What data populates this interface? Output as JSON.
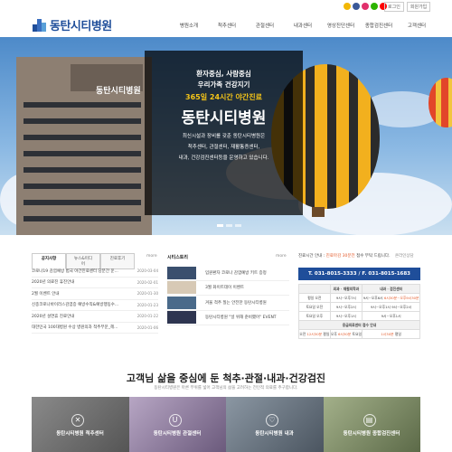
{
  "header": {
    "logo_text": "동탄시티병원",
    "util": [
      "로그인",
      "회원가입"
    ],
    "nav": [
      "병원소개",
      "척추센터",
      "관절센터",
      "내과센터",
      "영상진단센터",
      "종합검진센터",
      "고객센터"
    ],
    "social_colors": [
      "#f2b705",
      "#3b5998",
      "#e1306c",
      "#2db400",
      "#ff0000"
    ]
  },
  "hero": {
    "line1": "환자중심, 사람중심",
    "line2": "우리가족 건강지기",
    "line3": "365일 24시간 야간진료",
    "line4": "동탄시티병원",
    "desc1": "최신시설과 장비를 갖춘 동탄시티병원은",
    "desc2": "척추센터, 관절센터, 재활통증센터,",
    "desc3": "내과, 건강검진센터등을 운영하고 있습니다.",
    "building_sign": "동탄시티병원",
    "accent": "#f5c518"
  },
  "notice": {
    "tabs": [
      "공지사항",
      "뉴스&미디어",
      "진료후기"
    ],
    "more": "more",
    "items": [
      {
        "title": "코로나19 감염예방 범국 야간진료센터 당분간 운...",
        "date": "2020-03-04"
      },
      {
        "title": "2020년 의료진 휴진안내",
        "date": "2020-02-01"
      },
      {
        "title": "2월 이벤트 안내",
        "date": "2020-01-30"
      },
      {
        "title": "신종코로나바이러스감염증 예방수칙&예방행동수...",
        "date": "2020-01-23"
      },
      {
        "title": "2020년 설연휴 진료안내",
        "date": "2020-01-22"
      },
      {
        "title": "대한민국 100대병원 수상 병원의과 척추부문_헤...",
        "date": "2020-01-06"
      }
    ]
  },
  "sns": {
    "title": "시티스토리",
    "more": "more",
    "items": [
      "입원환자 코로나 감염예방 키트 증정",
      "3월 화이트데이 이벤트",
      "겨울 척추 질는 안전한 동탄시티병원",
      "동탄시티병원 \"널 위해 준비했어\" EVENT"
    ]
  },
  "schedule": {
    "label_prefix": "진료시간 안내 :",
    "label_red": "진료마감 30분전",
    "label_suffix": "접수 부탁 드립니다.",
    "more": "온라인상담",
    "tel": "T. 031-8015-3333 / F. 031-8015-1683",
    "head": [
      "",
      "외과 · 재활의학과",
      "내과 · 검진센터"
    ],
    "rows": [
      [
        "평일 오전",
        "9시~오후7시",
        "9시~오후6시",
        "6시30분~오후9시30분"
      ],
      [
        "토요일 오전",
        "9시~오후2시",
        "9시~오후1시",
        "9시~오후2시"
      ],
      [
        "토요일 오후",
        "9시~오후1시",
        "9시~오후1시",
        ""
      ]
    ],
    "sub_head": "응급의료센터 접수 안내",
    "last": [
      "오전",
      "12시30분",
      "평일",
      "오후",
      "6시30분",
      "토요일",
      "1시30분",
      "평일"
    ]
  },
  "centers": {
    "title": "고객님 삶을 중심에 둔 척추·관절·내과·건강검진",
    "subtitle": "동탄시티병원은 마른 부위를 넓어 고객님의 삶을 고려하는 전인적 의료를 추구합니다.",
    "cards": [
      {
        "label": "동탄시티병원 척추센터",
        "icon": "spine-icon",
        "color": "#7a7a7a"
      },
      {
        "label": "동탄시티병원 관절센터",
        "icon": "joint-icon",
        "color": "#8e7e9c"
      },
      {
        "label": "동탄시티병원 내과",
        "icon": "stethoscope-icon",
        "color": "#6e7a86"
      },
      {
        "label": "동탄시티병원 종합검진센터",
        "icon": "clipboard-icon",
        "color": "#7c8c6a"
      }
    ]
  }
}
